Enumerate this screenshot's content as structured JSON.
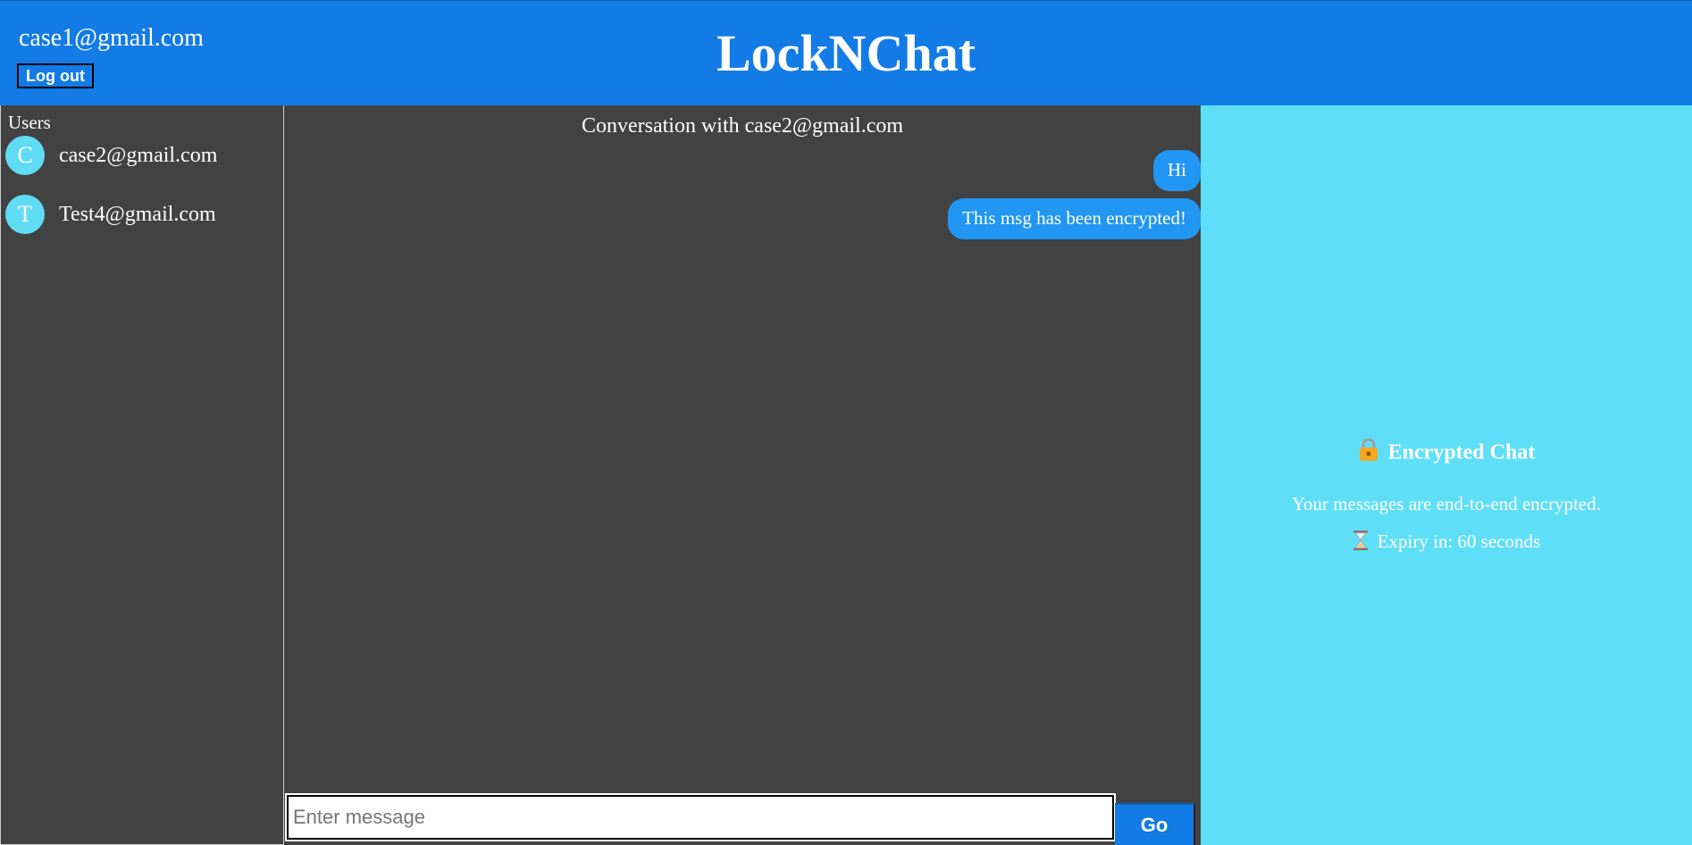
{
  "header": {
    "user_email": "case1@gmail.com",
    "logout_label": "Log out",
    "app_title": "LockNChat"
  },
  "sidebar": {
    "title": "Users",
    "users": [
      {
        "initial": "C",
        "email": "case2@gmail.com"
      },
      {
        "initial": "T",
        "email": "Test4@gmail.com"
      }
    ]
  },
  "conversation": {
    "title": "Conversation with case2@gmail.com",
    "messages": [
      {
        "text": "Hi"
      },
      {
        "text": "This msg has been encrypted!"
      }
    ],
    "input_placeholder": "Enter message",
    "input_value": "",
    "send_label": "Go"
  },
  "info_panel": {
    "heading": "Encrypted Chat",
    "description": "Your messages are end-to-end encrypted.",
    "expiry": "Expiry in: 60 seconds",
    "lock_icon": "lock-icon",
    "hourglass_icon": "hourglass-icon"
  },
  "colors": {
    "header": "#127be6",
    "panel_dark": "#424242",
    "info_panel": "#5fdff7",
    "bubble": "#2196f3",
    "avatar": "#5fdcf3"
  }
}
